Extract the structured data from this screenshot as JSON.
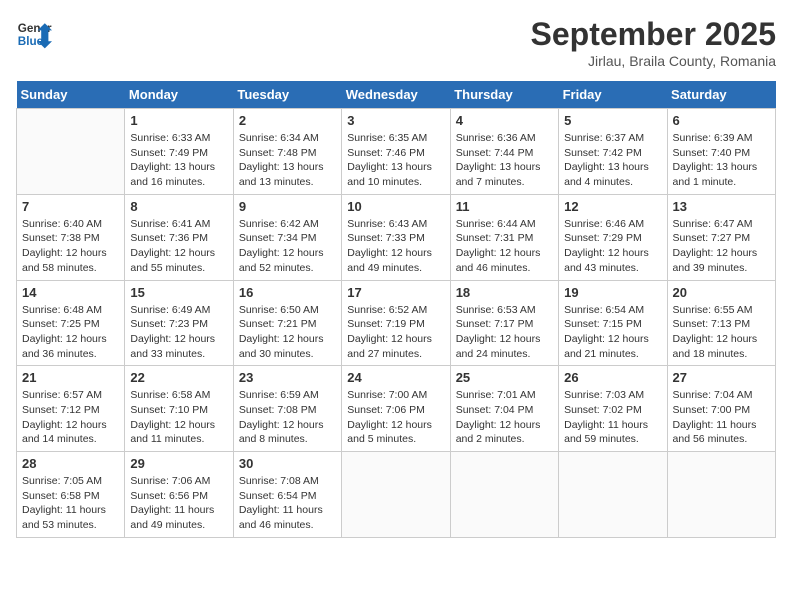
{
  "header": {
    "logo_line1": "General",
    "logo_line2": "Blue",
    "month": "September 2025",
    "location": "Jirlau, Braila County, Romania"
  },
  "weekdays": [
    "Sunday",
    "Monday",
    "Tuesday",
    "Wednesday",
    "Thursday",
    "Friday",
    "Saturday"
  ],
  "weeks": [
    [
      {
        "day": "",
        "sunrise": "",
        "sunset": "",
        "daylight": ""
      },
      {
        "day": "1",
        "sunrise": "Sunrise: 6:33 AM",
        "sunset": "Sunset: 7:49 PM",
        "daylight": "Daylight: 13 hours and 16 minutes."
      },
      {
        "day": "2",
        "sunrise": "Sunrise: 6:34 AM",
        "sunset": "Sunset: 7:48 PM",
        "daylight": "Daylight: 13 hours and 13 minutes."
      },
      {
        "day": "3",
        "sunrise": "Sunrise: 6:35 AM",
        "sunset": "Sunset: 7:46 PM",
        "daylight": "Daylight: 13 hours and 10 minutes."
      },
      {
        "day": "4",
        "sunrise": "Sunrise: 6:36 AM",
        "sunset": "Sunset: 7:44 PM",
        "daylight": "Daylight: 13 hours and 7 minutes."
      },
      {
        "day": "5",
        "sunrise": "Sunrise: 6:37 AM",
        "sunset": "Sunset: 7:42 PM",
        "daylight": "Daylight: 13 hours and 4 minutes."
      },
      {
        "day": "6",
        "sunrise": "Sunrise: 6:39 AM",
        "sunset": "Sunset: 7:40 PM",
        "daylight": "Daylight: 13 hours and 1 minute."
      }
    ],
    [
      {
        "day": "7",
        "sunrise": "Sunrise: 6:40 AM",
        "sunset": "Sunset: 7:38 PM",
        "daylight": "Daylight: 12 hours and 58 minutes."
      },
      {
        "day": "8",
        "sunrise": "Sunrise: 6:41 AM",
        "sunset": "Sunset: 7:36 PM",
        "daylight": "Daylight: 12 hours and 55 minutes."
      },
      {
        "day": "9",
        "sunrise": "Sunrise: 6:42 AM",
        "sunset": "Sunset: 7:34 PM",
        "daylight": "Daylight: 12 hours and 52 minutes."
      },
      {
        "day": "10",
        "sunrise": "Sunrise: 6:43 AM",
        "sunset": "Sunset: 7:33 PM",
        "daylight": "Daylight: 12 hours and 49 minutes."
      },
      {
        "day": "11",
        "sunrise": "Sunrise: 6:44 AM",
        "sunset": "Sunset: 7:31 PM",
        "daylight": "Daylight: 12 hours and 46 minutes."
      },
      {
        "day": "12",
        "sunrise": "Sunrise: 6:46 AM",
        "sunset": "Sunset: 7:29 PM",
        "daylight": "Daylight: 12 hours and 43 minutes."
      },
      {
        "day": "13",
        "sunrise": "Sunrise: 6:47 AM",
        "sunset": "Sunset: 7:27 PM",
        "daylight": "Daylight: 12 hours and 39 minutes."
      }
    ],
    [
      {
        "day": "14",
        "sunrise": "Sunrise: 6:48 AM",
        "sunset": "Sunset: 7:25 PM",
        "daylight": "Daylight: 12 hours and 36 minutes."
      },
      {
        "day": "15",
        "sunrise": "Sunrise: 6:49 AM",
        "sunset": "Sunset: 7:23 PM",
        "daylight": "Daylight: 12 hours and 33 minutes."
      },
      {
        "day": "16",
        "sunrise": "Sunrise: 6:50 AM",
        "sunset": "Sunset: 7:21 PM",
        "daylight": "Daylight: 12 hours and 30 minutes."
      },
      {
        "day": "17",
        "sunrise": "Sunrise: 6:52 AM",
        "sunset": "Sunset: 7:19 PM",
        "daylight": "Daylight: 12 hours and 27 minutes."
      },
      {
        "day": "18",
        "sunrise": "Sunrise: 6:53 AM",
        "sunset": "Sunset: 7:17 PM",
        "daylight": "Daylight: 12 hours and 24 minutes."
      },
      {
        "day": "19",
        "sunrise": "Sunrise: 6:54 AM",
        "sunset": "Sunset: 7:15 PM",
        "daylight": "Daylight: 12 hours and 21 minutes."
      },
      {
        "day": "20",
        "sunrise": "Sunrise: 6:55 AM",
        "sunset": "Sunset: 7:13 PM",
        "daylight": "Daylight: 12 hours and 18 minutes."
      }
    ],
    [
      {
        "day": "21",
        "sunrise": "Sunrise: 6:57 AM",
        "sunset": "Sunset: 7:12 PM",
        "daylight": "Daylight: 12 hours and 14 minutes."
      },
      {
        "day": "22",
        "sunrise": "Sunrise: 6:58 AM",
        "sunset": "Sunset: 7:10 PM",
        "daylight": "Daylight: 12 hours and 11 minutes."
      },
      {
        "day": "23",
        "sunrise": "Sunrise: 6:59 AM",
        "sunset": "Sunset: 7:08 PM",
        "daylight": "Daylight: 12 hours and 8 minutes."
      },
      {
        "day": "24",
        "sunrise": "Sunrise: 7:00 AM",
        "sunset": "Sunset: 7:06 PM",
        "daylight": "Daylight: 12 hours and 5 minutes."
      },
      {
        "day": "25",
        "sunrise": "Sunrise: 7:01 AM",
        "sunset": "Sunset: 7:04 PM",
        "daylight": "Daylight: 12 hours and 2 minutes."
      },
      {
        "day": "26",
        "sunrise": "Sunrise: 7:03 AM",
        "sunset": "Sunset: 7:02 PM",
        "daylight": "Daylight: 11 hours and 59 minutes."
      },
      {
        "day": "27",
        "sunrise": "Sunrise: 7:04 AM",
        "sunset": "Sunset: 7:00 PM",
        "daylight": "Daylight: 11 hours and 56 minutes."
      }
    ],
    [
      {
        "day": "28",
        "sunrise": "Sunrise: 7:05 AM",
        "sunset": "Sunset: 6:58 PM",
        "daylight": "Daylight: 11 hours and 53 minutes."
      },
      {
        "day": "29",
        "sunrise": "Sunrise: 7:06 AM",
        "sunset": "Sunset: 6:56 PM",
        "daylight": "Daylight: 11 hours and 49 minutes."
      },
      {
        "day": "30",
        "sunrise": "Sunrise: 7:08 AM",
        "sunset": "Sunset: 6:54 PM",
        "daylight": "Daylight: 11 hours and 46 minutes."
      },
      {
        "day": "",
        "sunrise": "",
        "sunset": "",
        "daylight": ""
      },
      {
        "day": "",
        "sunrise": "",
        "sunset": "",
        "daylight": ""
      },
      {
        "day": "",
        "sunrise": "",
        "sunset": "",
        "daylight": ""
      },
      {
        "day": "",
        "sunrise": "",
        "sunset": "",
        "daylight": ""
      }
    ]
  ]
}
